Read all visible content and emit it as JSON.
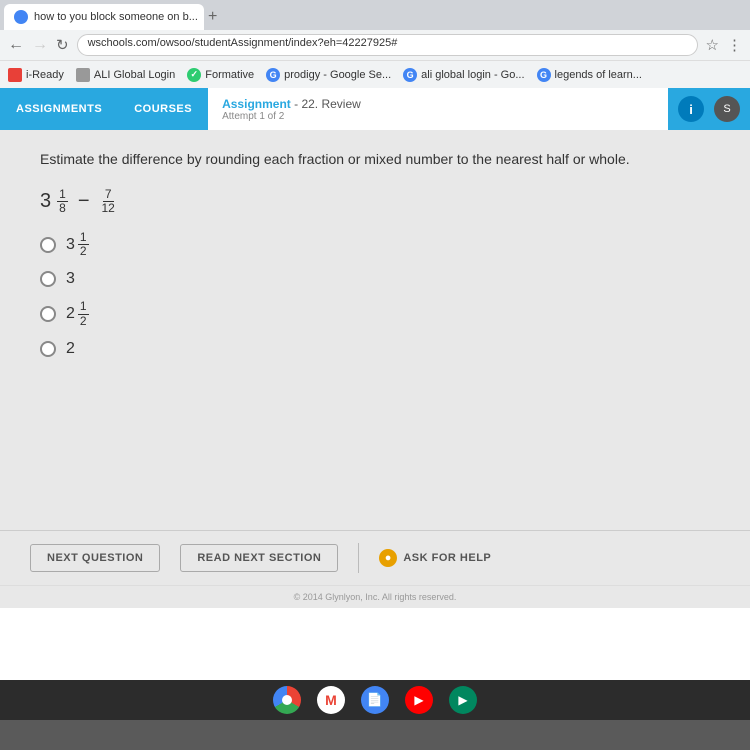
{
  "browser": {
    "tab_title": "how to you block someone on b...",
    "address": "wschools.com/owsoo/studentAssignment/index?eh=42227925#",
    "tab_plus": "+",
    "bookmarks": [
      {
        "label": "i-Ready",
        "color": "#e84038"
      },
      {
        "label": "ALI Global Login",
        "color": "#888"
      },
      {
        "label": "Formative",
        "color": "#2ecc71"
      },
      {
        "label": "prodigy - Google Se...",
        "color": "#4285f4"
      },
      {
        "label": "ali global login - Go...",
        "color": "#4285f4"
      },
      {
        "label": "legends of learn...",
        "color": "#4285f4"
      }
    ]
  },
  "app": {
    "nav": {
      "assignments_label": "ASSIGNMENTS",
      "courses_label": "COURSES"
    },
    "assignment": {
      "title": "Assignment",
      "subtitle": "- 22. Review",
      "attempt": "Attempt 1 of 2"
    }
  },
  "question": {
    "prompt": "Estimate the difference by rounding each fraction or mixed number to the nearest half or whole.",
    "expression": "3⅛ - 7/12",
    "options": [
      {
        "id": "a",
        "label": "3½"
      },
      {
        "id": "b",
        "label": "3"
      },
      {
        "id": "c",
        "label": "2½"
      },
      {
        "id": "d",
        "label": "2"
      }
    ]
  },
  "buttons": {
    "next_question": "NEXT QUESTION",
    "read_next_section": "READ NEXT SECTION",
    "ask_for_help": "ASK FOR HELP"
  },
  "footer": {
    "copyright": "© 2014 Glynlyon, Inc. All rights reserved."
  },
  "taskbar": {
    "icons": [
      "chrome",
      "gmail",
      "files",
      "youtube",
      "play"
    ]
  }
}
